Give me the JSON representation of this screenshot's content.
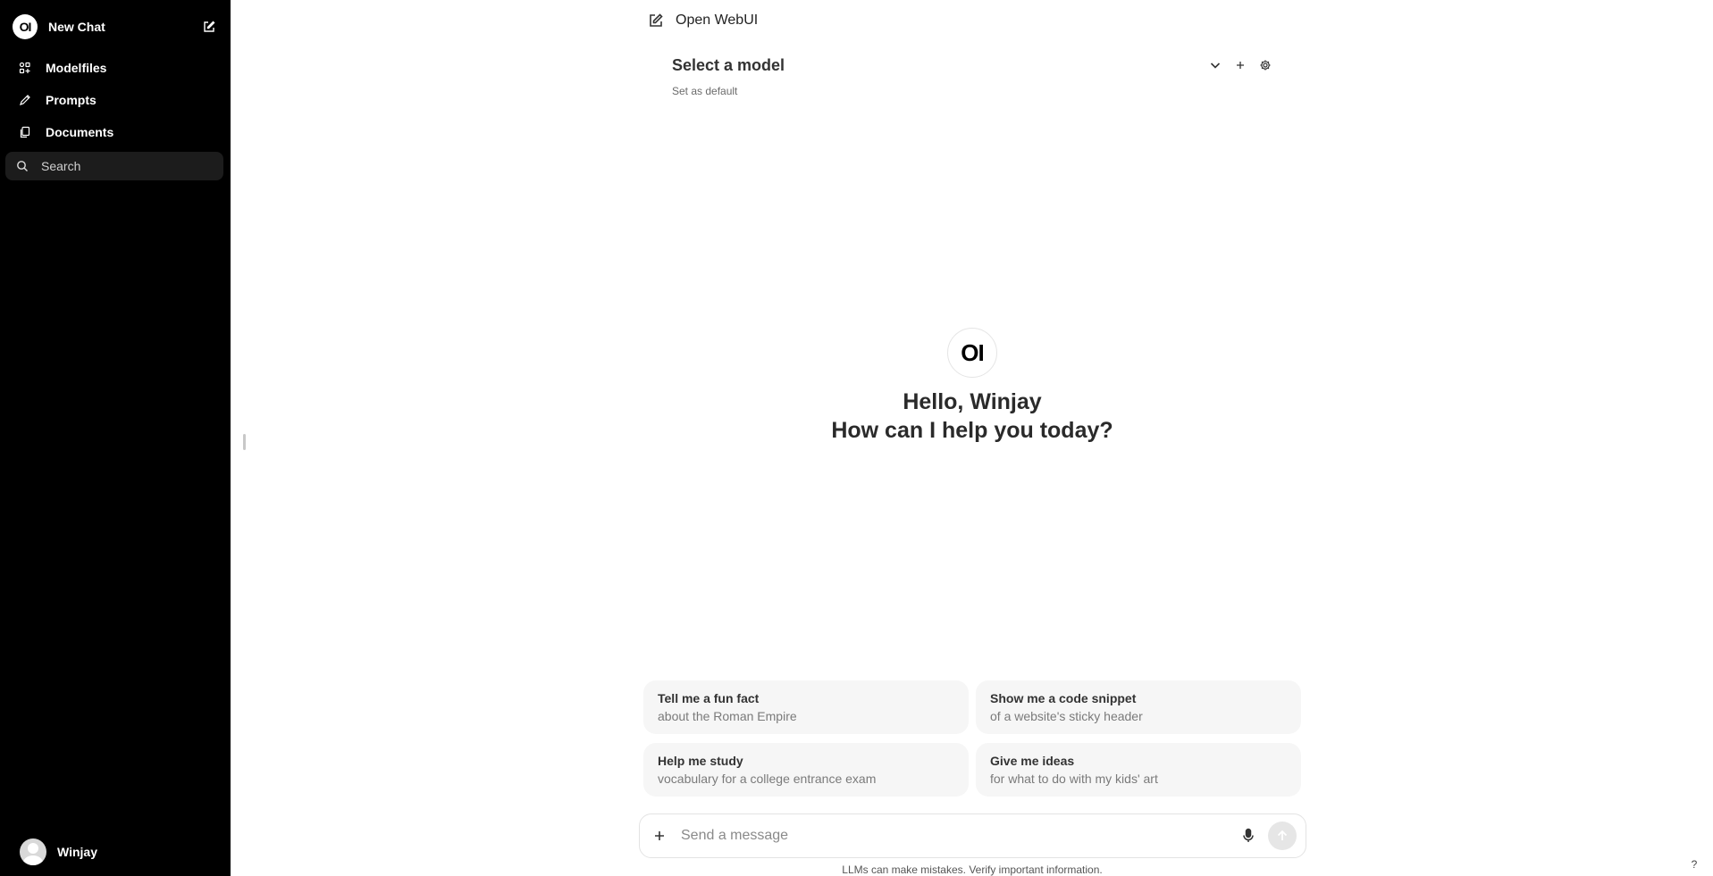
{
  "sidebar": {
    "logo_text": "OI",
    "new_chat_label": "New Chat",
    "items": [
      {
        "label": "Modelfiles",
        "icon": "modelfiles-icon"
      },
      {
        "label": "Prompts",
        "icon": "pencil-icon"
      },
      {
        "label": "Documents",
        "icon": "documents-icon"
      }
    ],
    "search_placeholder": "Search",
    "user_name": "Winjay"
  },
  "header": {
    "title": "Open WebUI"
  },
  "model": {
    "select_label": "Select a model",
    "set_default_label": "Set as default"
  },
  "greeting": {
    "logo_text": "OI",
    "line1": "Hello, Winjay",
    "line2": "How can I help you today?"
  },
  "suggestions": [
    {
      "title": "Tell me a fun fact",
      "subtitle": "about the Roman Empire"
    },
    {
      "title": "Show me a code snippet",
      "subtitle": "of a website's sticky header"
    },
    {
      "title": "Help me study",
      "subtitle": "vocabulary for a college entrance exam"
    },
    {
      "title": "Give me ideas",
      "subtitle": "for what to do with my kids' art"
    }
  ],
  "composer": {
    "placeholder": "Send a message"
  },
  "disclaimer": "LLMs can make mistakes. Verify important information.",
  "help_label": "?",
  "colors": {
    "sidebar_bg": "#000000",
    "search_bg": "#1c1c1c",
    "suggestion_bg": "#f6f6f6"
  }
}
